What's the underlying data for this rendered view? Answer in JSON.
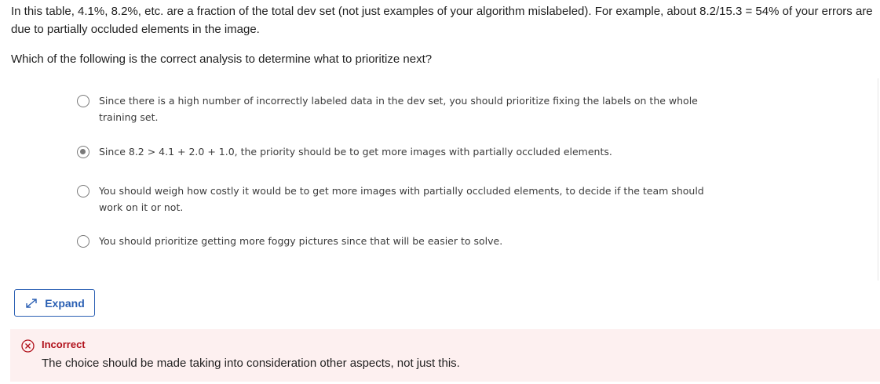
{
  "intro_text": "In this table, 4.1%, 8.2%, etc. are a fraction of the total dev set (not just examples of your algorithm mislabeled). For example, about 8.2/15.3 = 54% of your errors are due to partially occluded elements in the image.",
  "question": "Which of the following is the correct analysis to determine what to prioritize next?",
  "options": [
    {
      "label": "Since there is a high number of incorrectly labeled data in the dev set, you should prioritize fixing the labels on the whole training set.",
      "selected": false
    },
    {
      "label": "Since 8.2 > 4.1 + 2.0 + 1.0, the priority should be to get more images with partially occluded elements.",
      "selected": true
    },
    {
      "label": "You should weigh how costly it would be to get more images with partially occluded elements, to decide if the team should work on it or not.",
      "selected": false
    },
    {
      "label": "You should prioritize getting more foggy pictures since that will be easier to solve.",
      "selected": false
    }
  ],
  "expand_button": {
    "label": "Expand",
    "icon": "expand-arrows-icon"
  },
  "feedback": {
    "status": "Incorrect",
    "icon": "error-circle-x-icon",
    "message": "The choice should be made taking into consideration other aspects, not just this.",
    "colors": {
      "accent": "#b1111b",
      "background": "#fdf0f0"
    }
  },
  "colors": {
    "link": "#2a5fb3",
    "radio": "#7a7a7a"
  }
}
